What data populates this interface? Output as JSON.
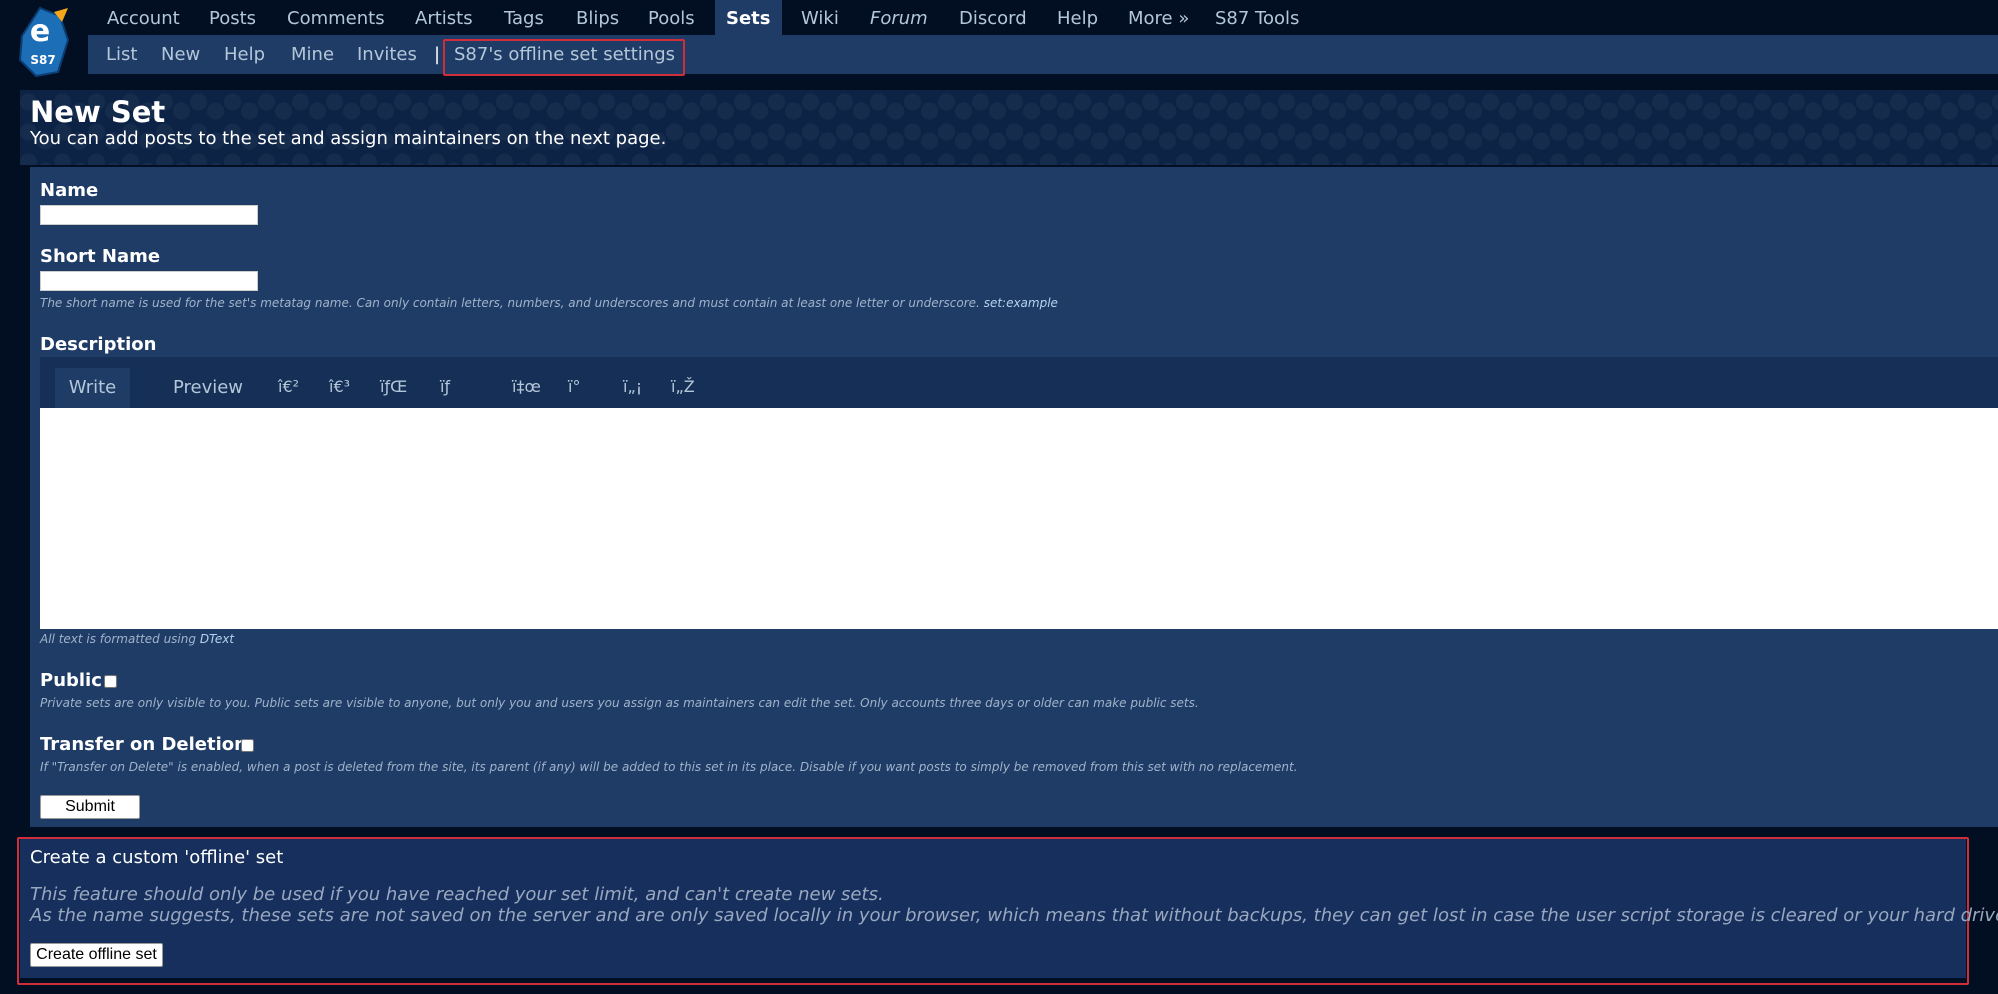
{
  "nav": {
    "items": [
      {
        "label": "Account"
      },
      {
        "label": "Posts"
      },
      {
        "label": "Comments"
      },
      {
        "label": "Artists"
      },
      {
        "label": "Tags"
      },
      {
        "label": "Blips"
      },
      {
        "label": "Pools"
      },
      {
        "label": "Sets",
        "active": true
      },
      {
        "label": "Wiki"
      },
      {
        "label": "Forum"
      },
      {
        "label": "Discord"
      },
      {
        "label": "Help"
      },
      {
        "label": "More »"
      },
      {
        "label": "S87 Tools"
      }
    ],
    "logo_text": "e",
    "logo_sub": "S87"
  },
  "subnav": {
    "items": [
      {
        "label": "List"
      },
      {
        "label": "New"
      },
      {
        "label": "Help"
      },
      {
        "label": "Mine"
      },
      {
        "label": "Invites"
      }
    ],
    "separator": "|",
    "offline_settings_label": "S87's offline set settings"
  },
  "page": {
    "title": "New Set",
    "subtitle": "You can add posts to the set and assign maintainers on the next page."
  },
  "form": {
    "name_label": "Name",
    "name_value": "",
    "short_name_label": "Short Name",
    "short_name_value": "",
    "short_name_hint": "The short name is used for the set's metatag name. Can only contain letters, numbers, and underscores and must contain at least one letter or underscore.",
    "short_name_hint_example": "set:example",
    "description_label": "Description",
    "tabs": {
      "write": "Write",
      "preview": "Preview"
    },
    "toolbar": [
      "î€²",
      "î€³",
      "ïƒŒ",
      "ïƒ",
      "ï‡œ",
      "ï°",
      "ï„¡",
      "ï„Ž"
    ],
    "description_value": "",
    "dtext_hint_prefix": "All text is formatted using",
    "dtext_link": "DText",
    "public_label": "Public",
    "public_checked": false,
    "public_hint": "Private sets are only visible to you. Public sets are visible to anyone, but only you and users you assign as maintainers can edit the set. Only accounts three days or older can make public sets.",
    "transfer_label": "Transfer on Deletion",
    "transfer_checked": false,
    "transfer_hint": "If \"Transfer on Delete\" is enabled, when a post is deleted from the site, its parent (if any) will be added to this set in its place. Disable if you want posts to simply be removed from this set with no replacement.",
    "submit_label": "Submit"
  },
  "offline": {
    "title": "Create a custom 'offline' set",
    "line1": "This feature should only be used if you have reached your set limit, and can't create new sets.",
    "line2": "As the name suggests, these sets are not saved on the server and are only saved locally in your browser, which means that without backups, they can get lost in case the user script storage is cleared or your hard drive fails.",
    "button_label": "Create offline set"
  },
  "colors": {
    "background": "#020f23",
    "panel": "#1f3c67",
    "link": "#b4c7d9",
    "highlight_border": "#d02e3a"
  }
}
